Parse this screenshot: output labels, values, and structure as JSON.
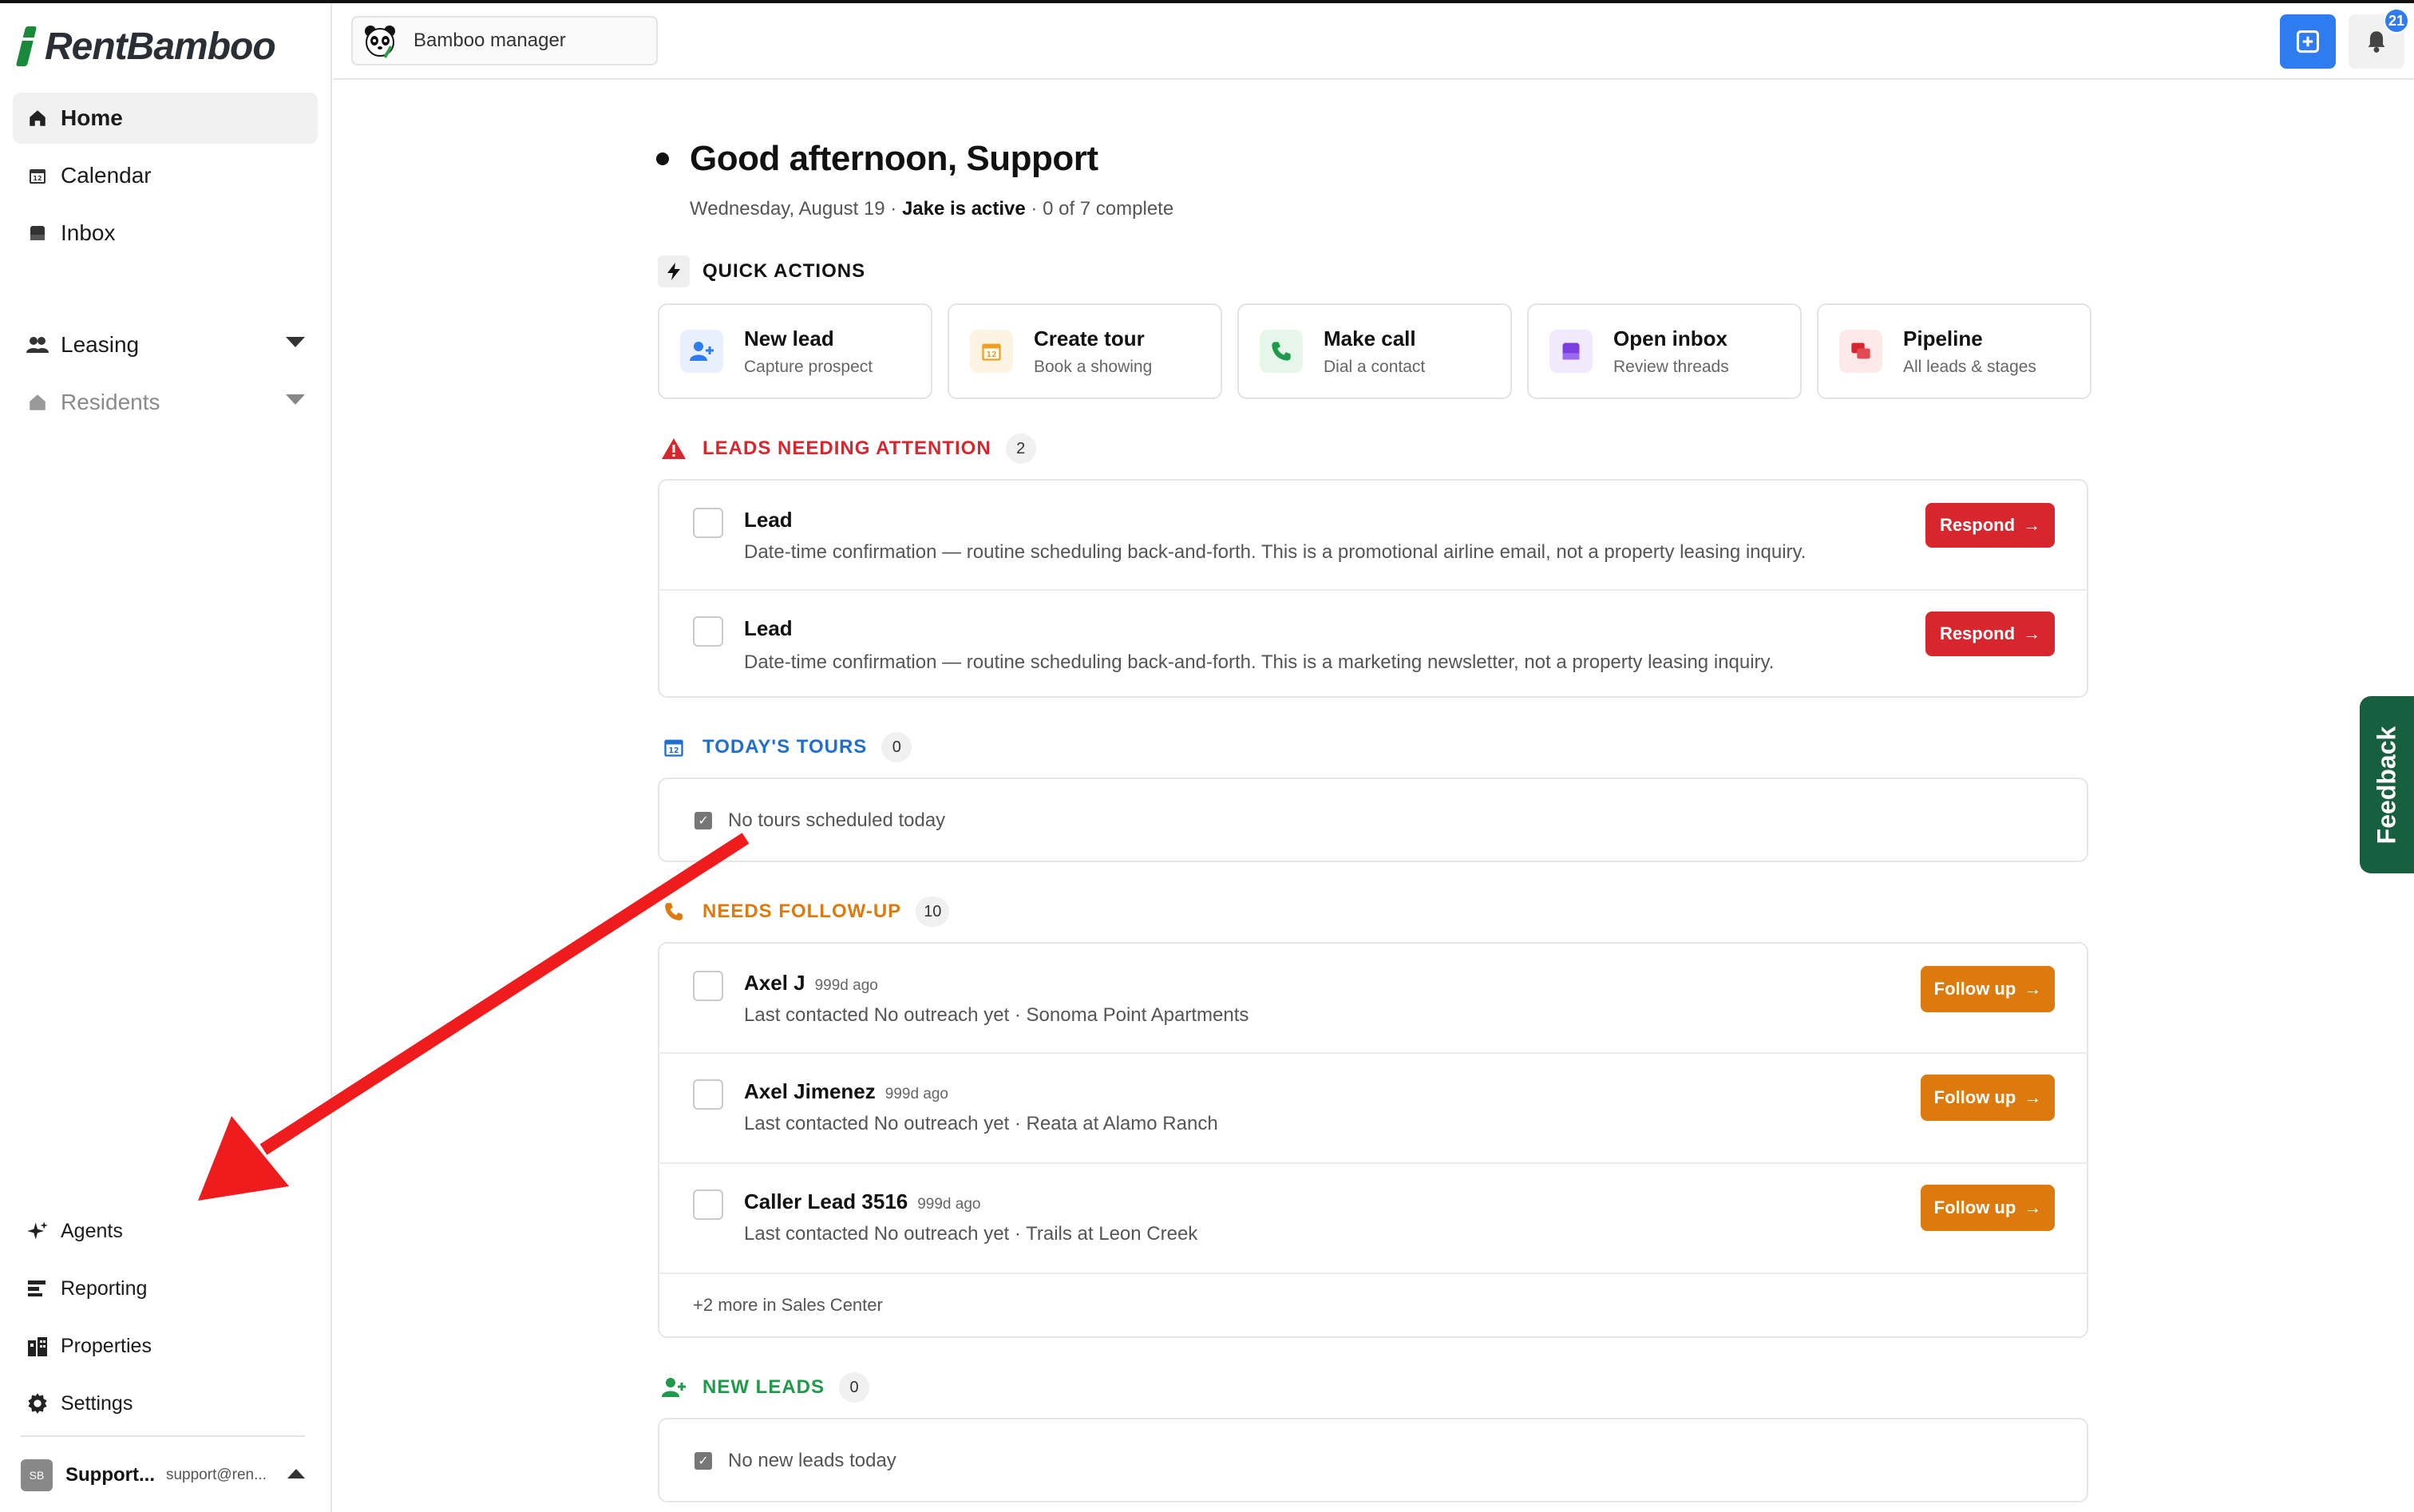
{
  "brand": {
    "name": "RentBamboo"
  },
  "sidebar": {
    "nav": [
      {
        "label": "Home"
      },
      {
        "label": "Calendar"
      },
      {
        "label": "Inbox"
      },
      {
        "label": "Leasing"
      },
      {
        "label": "Residents"
      }
    ],
    "bottom": [
      {
        "label": "Agents"
      },
      {
        "label": "Reporting"
      },
      {
        "label": "Properties"
      },
      {
        "label": "Settings"
      }
    ],
    "user": {
      "initials": "SB",
      "name": "Support...",
      "email": "support@ren..."
    }
  },
  "topbar": {
    "workspace_label": "Bamboo manager",
    "notification_count": "21"
  },
  "greeting": {
    "title": "Good afternoon, Support",
    "date": "Wednesday, August 19",
    "active": "Jake is active",
    "progress": "0 of 7 complete"
  },
  "quick_actions": {
    "title": "QUICK ACTIONS",
    "items": [
      {
        "title": "New lead",
        "sub": "Capture prospect"
      },
      {
        "title": "Create tour",
        "sub": "Book a showing"
      },
      {
        "title": "Make call",
        "sub": "Dial a contact"
      },
      {
        "title": "Open inbox",
        "sub": "Review threads"
      },
      {
        "title": "Pipeline",
        "sub": "All leads & stages"
      }
    ]
  },
  "attention": {
    "title": "LEADS NEEDING ATTENTION",
    "count": "2",
    "button_label": "Respond",
    "items": [
      {
        "title": "Lead",
        "desc": "Date-time confirmation — routine scheduling back-and-forth. This is a promotional airline email, not a property leasing inquiry."
      },
      {
        "title": "Lead",
        "desc": "Date-time confirmation — routine scheduling back-and-forth. This is a marketing newsletter, not a property leasing inquiry."
      }
    ]
  },
  "tours": {
    "title": "TODAY'S TOURS",
    "count": "0",
    "empty": "No tours scheduled today"
  },
  "followup": {
    "title": "NEEDS FOLLOW-UP",
    "count": "10",
    "button_label": "Follow up",
    "items": [
      {
        "name": "Axel J",
        "ago": "999d ago",
        "desc": "Last contacted No outreach yet · Sonoma Point Apartments"
      },
      {
        "name": "Axel Jimenez",
        "ago": "999d ago",
        "desc": "Last contacted No outreach yet · Reata at Alamo Ranch"
      },
      {
        "name": "Caller Lead 3516",
        "ago": "999d ago",
        "desc": "Last contacted No outreach yet · Trails at Leon Creek"
      }
    ],
    "more": "+2 more in Sales Center"
  },
  "new_leads": {
    "title": "NEW LEADS",
    "count": "0",
    "empty": "No new leads today"
  },
  "feedback_label": "Feedback",
  "colors": {
    "accent_blue": "#2e7cf0",
    "danger_red": "#d7262d",
    "followup_orange": "#dd7a0e",
    "tours_blue": "#1f6fd1",
    "new_leads_green": "#1e9a4a",
    "feedback_green": "#17603f",
    "annotation_red": "#ee1c1c"
  }
}
